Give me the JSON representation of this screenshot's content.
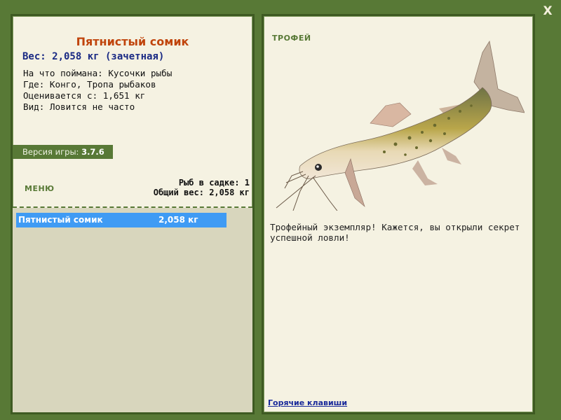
{
  "close_label": "X",
  "fish": {
    "name": "Пятнистый сомик",
    "weight_line": "Вес: 2,058 кг (зачетная)",
    "caught_on": "На что поймана: Кусочки рыбы",
    "where": "Где: Конго, Тропа рыбаков",
    "rated_from": "Оценивается с: 1,651 кг",
    "kind": "Вид: Ловится не часто"
  },
  "version": {
    "label": "Версия игры:",
    "value": "3.7.6"
  },
  "menu_label": "МЕНЮ",
  "cage": {
    "count_line": "Рыб в садке: 1",
    "total_line": "Общий вес: 2,058 кг"
  },
  "list": [
    {
      "name": "Пятнистый сомик",
      "weight": "2,058 кг"
    }
  ],
  "trophy": {
    "label": "ТРОФЕЙ",
    "description": "Трофейный экземпляр! Кажется, вы открыли секрет успешной ловли!"
  },
  "hotkeys_label": "Горячие клавиши",
  "colors": {
    "frame": "#587936",
    "panel": "#f5f2e2",
    "title": "#c0440c",
    "weight": "#1a2a84",
    "selection": "#3f9bf4"
  }
}
